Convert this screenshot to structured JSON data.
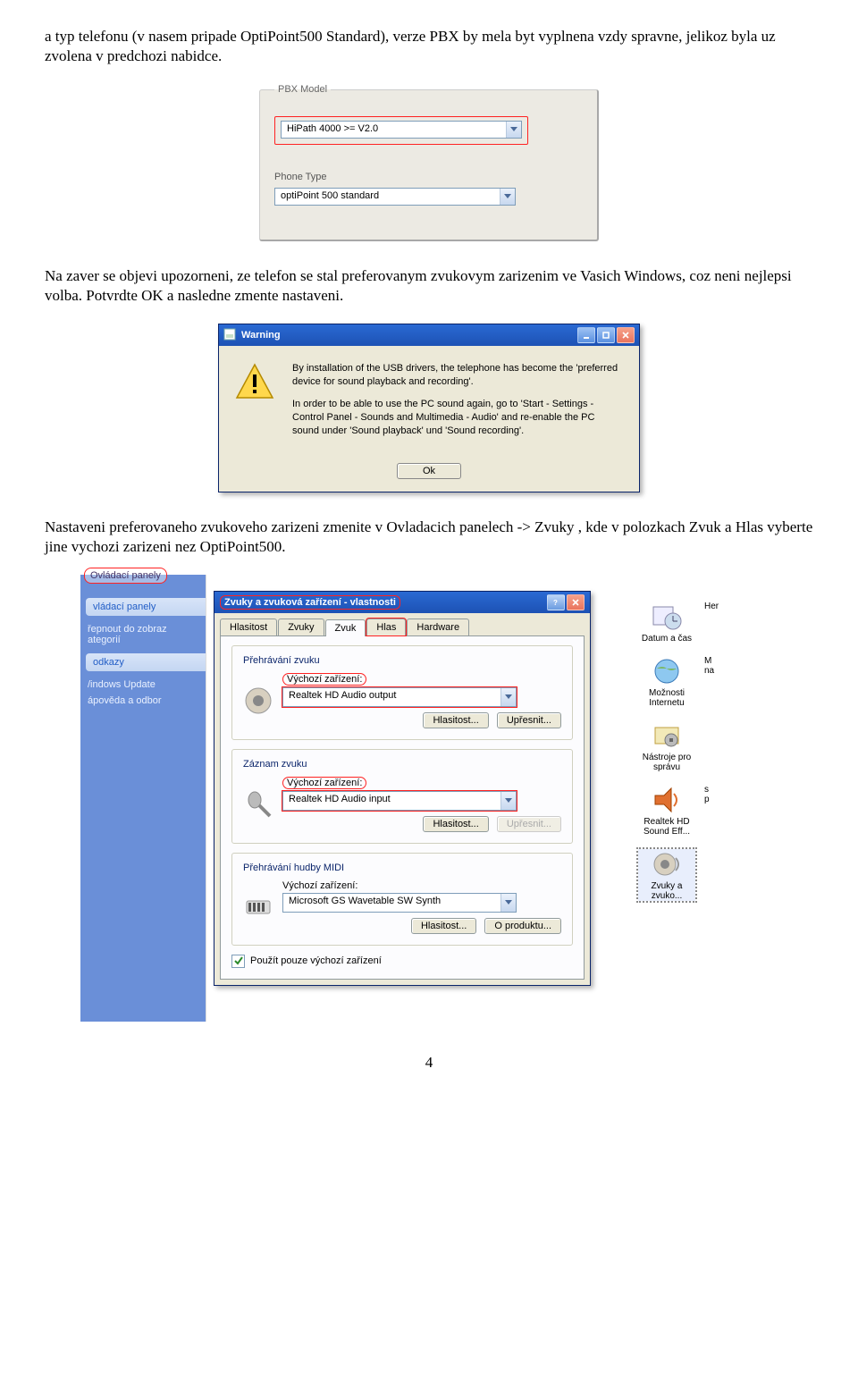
{
  "paragraphs": {
    "p1": "a typ telefonu (v nasem pripade OptiPoint500 Standard), verze PBX by mela byt vyplnena vzdy spravne, jelikoz byla uz zvolena v predchozi nabidce.",
    "p2": "Na zaver se objevi upozorneni, ze telefon se stal preferovanym zvukovym zarizenim ve Vasich Windows, coz neni nejlepsi volba. Potvrdte OK a nasledne zmente nastaveni.",
    "p3": "Nastaveni preferovaneho zvukoveho zarizeni zmenite  v Ovladacich panelech -> Zvuky , kde v polozkach Zvuk a Hlas vyberte jine vychozi zarizeni nez OptiPoint500."
  },
  "pbx": {
    "legend": "PBX Model",
    "model_value": "HiPath 4000 >= V2.0",
    "phone_type_label": "Phone Type",
    "phone_type_value": "optiPoint 500 standard"
  },
  "warning": {
    "title": "Warning",
    "line1": "By installation of the USB drivers, the telephone has become the 'preferred device for sound playback and recording'.",
    "line2": "In order to be able to use the PC sound again, go to 'Start - Settings - Control Panel - Sounds and Multimedia - Audio' and re-enable the PC sound under 'Sound playback' und 'Sound recording'.",
    "ok": "Ok"
  },
  "cp": {
    "overlay_caption": "Ovládací panely",
    "leftpane": {
      "header": "vládací panely",
      "switch_view": "řepnout do zobraz\nategorií",
      "links_header": "odkazy",
      "links": [
        "/indows Update",
        "ápověda a odbor"
      ]
    },
    "props_title": "Zvuky a zvuková zařízení - vlastnosti",
    "tabs": [
      "Hlasitost",
      "Zvuky",
      "Zvuk",
      "Hlas",
      "Hardware"
    ],
    "active_tab": "Zvuk",
    "circled_tab": "Hlas",
    "groups": {
      "playback": {
        "title": "Přehrávání zvuku",
        "label": "Výchozí zařízení:",
        "value": "Realtek HD Audio output",
        "btn_vol": "Hlasitost...",
        "btn_adv": "Upřesnit..."
      },
      "record": {
        "title": "Záznam zvuku",
        "label": "Výchozí zařízení:",
        "value": "Realtek HD Audio input",
        "btn_vol": "Hlasitost...",
        "btn_adv": "Upřesnit..."
      },
      "midi": {
        "title": "Přehrávání hudby MIDI",
        "label": "Výchozí zařízení:",
        "value": "Microsoft GS Wavetable SW Synth",
        "btn_vol": "Hlasitost...",
        "btn_about": "O produktu..."
      }
    },
    "checkbox": "Použít pouze výchozí zařízení",
    "right_items": [
      {
        "label": "Datum a čas"
      },
      {
        "label": "Možnosti Internetu"
      },
      {
        "label": "Nástroje pro správu"
      },
      {
        "label": "Realtek HD Sound Eff..."
      },
      {
        "label": "Zvuky a zvuko..."
      }
    ],
    "right_bleed": [
      "Her",
      "M\nna",
      "",
      "s\np",
      ""
    ]
  },
  "pagenum": "4"
}
